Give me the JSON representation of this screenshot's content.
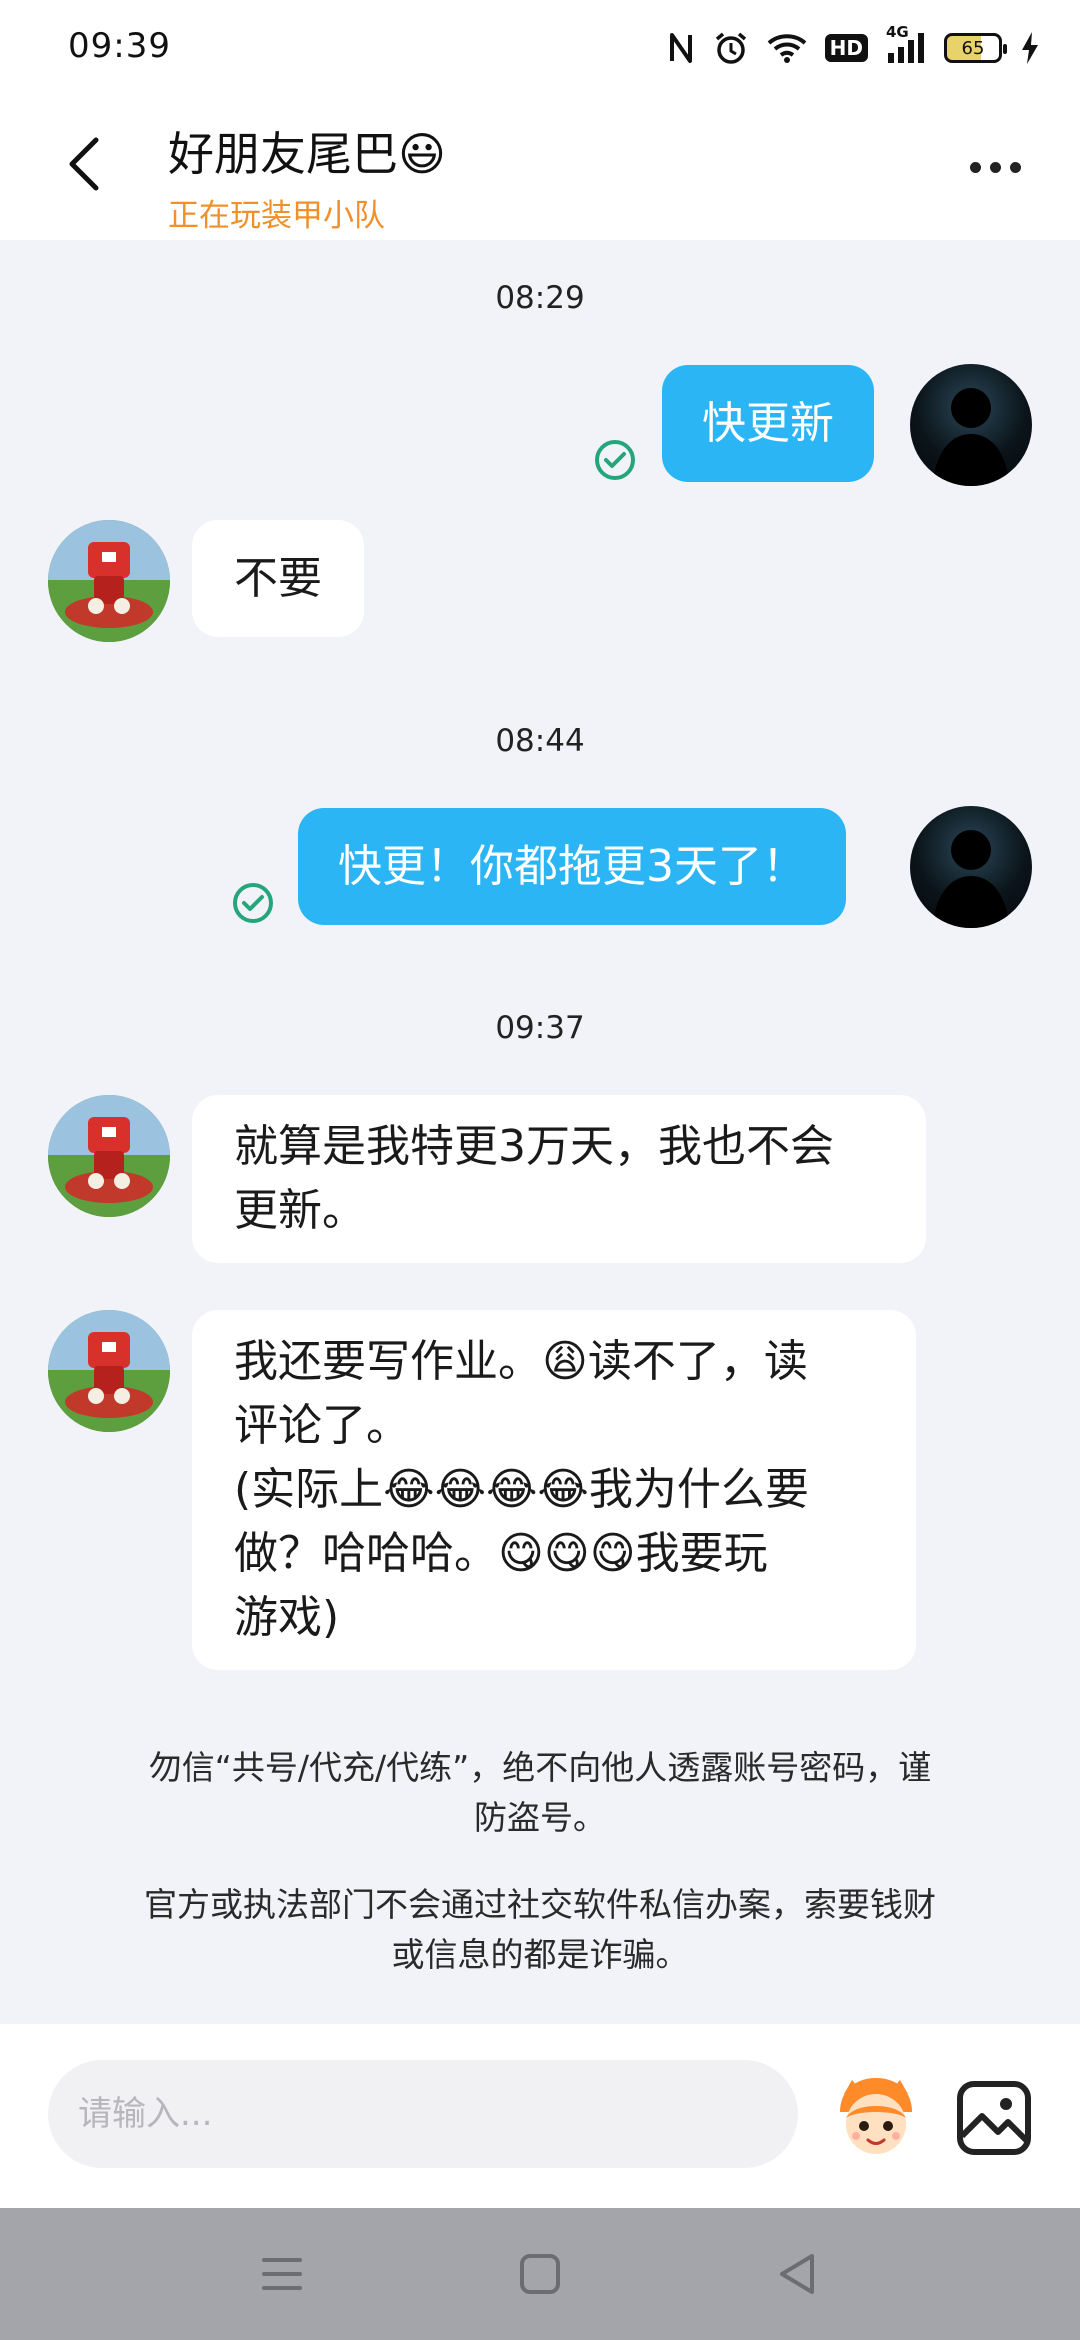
{
  "status_bar": {
    "time": "09:39",
    "icons": [
      "nfc-icon",
      "alarm-icon",
      "wifi-icon",
      "hd-icon",
      "signal-4g-icon",
      "battery-icon",
      "charging-icon"
    ],
    "hd_label": "HD",
    "network_label": "4G",
    "battery_level": "65"
  },
  "header": {
    "title": "好朋友尾巴😃",
    "status": "正在玩装甲小队"
  },
  "messages": [
    {
      "timestamp": "08:29"
    },
    {
      "sender": "self",
      "text": "快更新",
      "read": true
    },
    {
      "sender": "friend",
      "text": "不要"
    },
    {
      "timestamp": "08:44"
    },
    {
      "sender": "self",
      "text": "快更！你都拖更3天了！",
      "read": true
    },
    {
      "timestamp": "09:37"
    },
    {
      "sender": "friend",
      "lines": [
        "就算是我特更3万天，我也不会",
        "更新。"
      ]
    },
    {
      "sender": "friend",
      "lines": [
        "我还要写作业。😩读不了，读",
        "评论了。",
        "(实际上😂😂😂😂我为什么要",
        "做？哈哈哈。😋😋😋我要玩",
        "游戏)"
      ]
    }
  ],
  "notices": {
    "security_line1": "勿信“共号/代充/代练”，绝不向他人透露账号密码，谨",
    "security_line2": "防盗号。",
    "fraud_line1": "官方或执法部门不会通过社交软件私信办案，索要钱财",
    "fraud_line2": "或信息的都是诈骗。"
  },
  "input": {
    "placeholder": "请输入..."
  },
  "colors": {
    "accent_blue": "#2bb5f5",
    "status_orange": "#f0902a",
    "read_green": "#25a67a",
    "chat_background": "#f1f3f8"
  }
}
